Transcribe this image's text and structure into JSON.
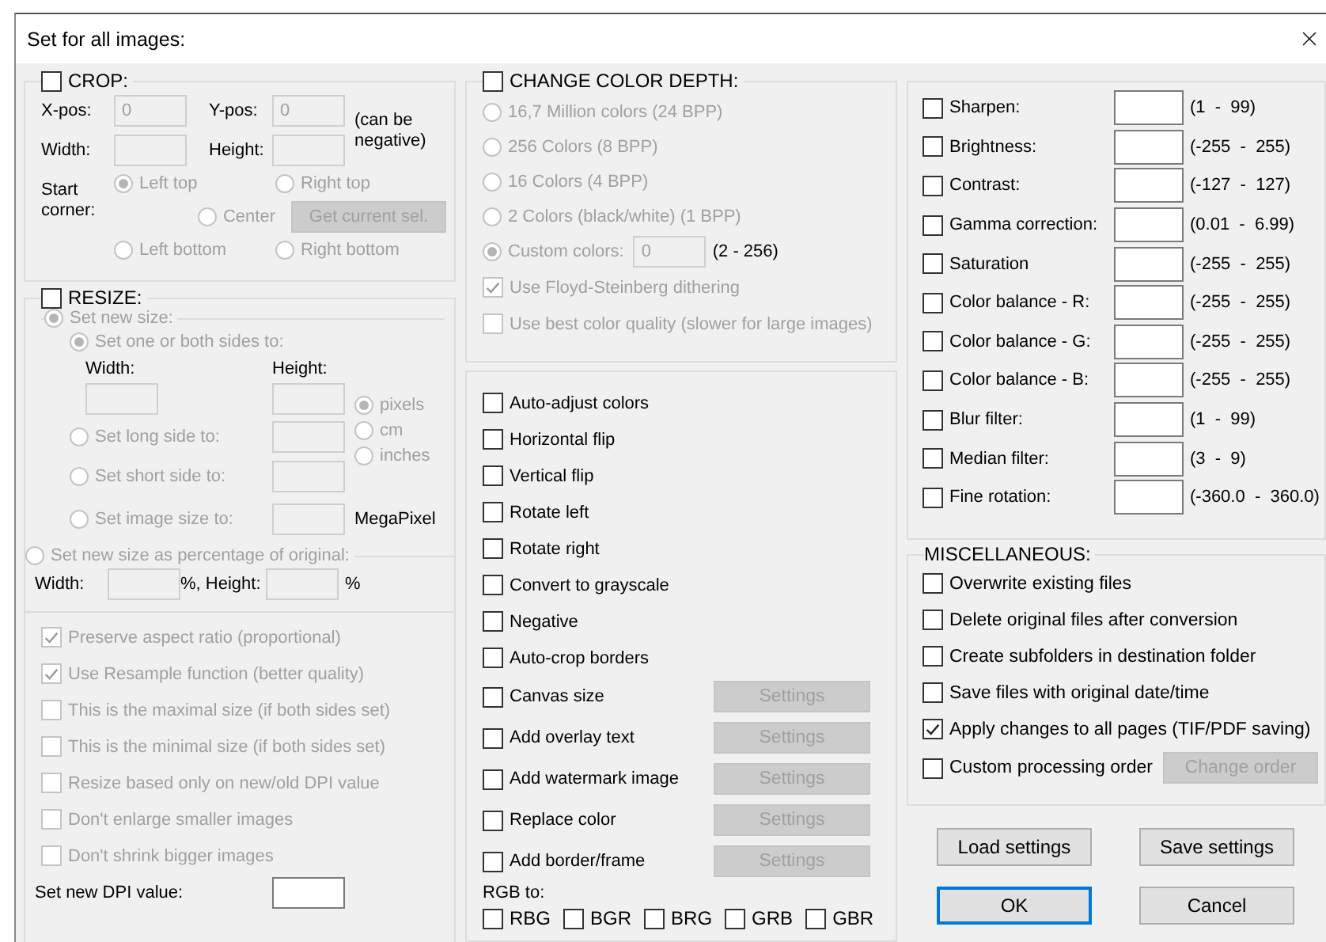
{
  "window": {
    "title": "Set for all images:"
  },
  "crop": {
    "label": "CROP:",
    "checked": false,
    "disabled": true,
    "fields": [
      {
        "label": "X-pos:",
        "value": "0"
      },
      {
        "label": "Y-pos:",
        "value": "0"
      },
      {
        "label": "Width:"
      },
      {
        "label": "Height:"
      }
    ],
    "note": "(can be negative)",
    "corner_label": "Start corner:",
    "corners": [
      {
        "label": "Left top",
        "selected": true
      },
      {
        "label": "Right top",
        "selected": false
      },
      {
        "label": "Center",
        "selected": false
      },
      {
        "label": "Left bottom",
        "selected": false
      },
      {
        "label": "Right bottom",
        "selected": false
      }
    ],
    "get_button": "Get current sel."
  },
  "resize": {
    "label": "RESIZE:",
    "checked": false,
    "disabled": true,
    "modes": [
      {
        "label": "Set new size:",
        "selected": true
      },
      {
        "label": "Set new size as percentage of original:",
        "selected": false
      }
    ],
    "size_options": [
      {
        "label": "Set one or both sides to:",
        "selected": true
      },
      {
        "label": "Set long side to:",
        "selected": false
      },
      {
        "label": "Set short side to:",
        "selected": false
      },
      {
        "label": "Set image size to:",
        "selected": false,
        "suffix": "MegaPixel"
      }
    ],
    "width_label": "Width:",
    "height_label": "Height:",
    "units": [
      {
        "label": "pixels",
        "selected": true
      },
      {
        "label": "cm",
        "selected": false
      },
      {
        "label": "inches",
        "selected": false
      }
    ],
    "percent": {
      "width_label": "Width:",
      "middle": "%, Height:",
      "end": "%"
    },
    "options": [
      {
        "label": "Preserve aspect ratio (proportional)",
        "checked": true,
        "disabled": true
      },
      {
        "label": "Use Resample function (better quality)",
        "checked": true,
        "disabled": true
      },
      {
        "label": "This is the maximal size (if both sides set)",
        "checked": false,
        "disabled": true
      },
      {
        "label": "This is the minimal size (if both sides set)",
        "checked": false,
        "disabled": true
      },
      {
        "label": "Resize based only on new/old DPI value",
        "checked": false,
        "disabled": true
      },
      {
        "label": "Don't enlarge smaller images",
        "checked": false,
        "disabled": true
      },
      {
        "label": "Don't shrink bigger images",
        "checked": false,
        "disabled": true
      }
    ],
    "dpi_label": "Set new DPI value:"
  },
  "color_depth": {
    "label": "CHANGE COLOR DEPTH:",
    "checked": false,
    "disabled": true,
    "options": [
      {
        "label": "16,7 Million colors (24 BPP)",
        "selected": false
      },
      {
        "label": "256 Colors (8 BPP)",
        "selected": false
      },
      {
        "label": "16 Colors (4 BPP)",
        "selected": false
      },
      {
        "label": "2 Colors (black/white) (1 BPP)",
        "selected": false
      },
      {
        "label": "Custom colors:",
        "selected": true,
        "value": "0",
        "range": "(2 - 256)"
      }
    ],
    "checks": [
      {
        "label": "Use Floyd-Steinberg dithering",
        "checked": true
      },
      {
        "label": "Use best color quality (slower for large images)",
        "checked": false
      }
    ]
  },
  "transforms": [
    {
      "label": "Auto-adjust colors",
      "checked": false
    },
    {
      "label": "Horizontal flip",
      "checked": false
    },
    {
      "label": "Vertical flip",
      "checked": false
    },
    {
      "label": "Rotate left",
      "checked": false
    },
    {
      "label": "Rotate right",
      "checked": false
    },
    {
      "label": "Convert to grayscale",
      "checked": false
    },
    {
      "label": "Negative",
      "checked": false
    },
    {
      "label": "Auto-crop borders",
      "checked": false
    },
    {
      "label": "Canvas size",
      "checked": false,
      "settings": {
        "label": "Settings",
        "disabled": true
      }
    },
    {
      "label": "Add overlay text",
      "checked": false,
      "settings": {
        "label": "Settings",
        "disabled": true
      }
    },
    {
      "label": "Add watermark image",
      "checked": false,
      "settings": {
        "label": "Settings",
        "disabled": true
      }
    },
    {
      "label": "Replace color",
      "checked": false,
      "settings": {
        "label": "Settings",
        "disabled": true
      }
    },
    {
      "label": "Add border/frame",
      "checked": false,
      "settings": {
        "label": "Settings",
        "disabled": true
      }
    }
  ],
  "rgb_label": "RGB to:",
  "rgb": [
    {
      "label": "RBG",
      "checked": false
    },
    {
      "label": "BGR",
      "checked": false
    },
    {
      "label": "BRG",
      "checked": false
    },
    {
      "label": "GRB",
      "checked": false
    },
    {
      "label": "GBR",
      "checked": false
    }
  ],
  "filters": [
    {
      "label": "Sharpen:",
      "checked": false,
      "range": "(1  -  99)"
    },
    {
      "label": "Brightness:",
      "checked": false,
      "range": "(-255  -  255)"
    },
    {
      "label": "Contrast:",
      "checked": false,
      "range": "(-127  -  127)"
    },
    {
      "label": "Gamma correction:",
      "checked": false,
      "range": "(0.01  -  6.99)"
    },
    {
      "label": "Saturation",
      "checked": false,
      "range": "(-255  -  255)"
    },
    {
      "label": "Color balance - R:",
      "checked": false,
      "range": "(-255  -  255)"
    },
    {
      "label": "Color balance - G:",
      "checked": false,
      "range": "(-255  -  255)"
    },
    {
      "label": "Color balance - B:",
      "checked": false,
      "range": "(-255  -  255)"
    },
    {
      "label": "Blur filter:",
      "checked": false,
      "range": "(1  -  99)"
    },
    {
      "label": "Median filter:",
      "checked": false,
      "range": "(3  -  9)"
    },
    {
      "label": "Fine rotation:",
      "checked": false,
      "range": "(-360.0  -  360.0)"
    }
  ],
  "misc": {
    "title": "MISCELLANEOUS:",
    "items": [
      {
        "label": "Overwrite existing files",
        "checked": false
      },
      {
        "label": "Delete original files after conversion",
        "checked": false
      },
      {
        "label": "Create subfolders in destination folder",
        "checked": false
      },
      {
        "label": "Save files with original date/time",
        "checked": false
      },
      {
        "label": "Apply changes to all pages (TIF/PDF saving)",
        "checked": true
      },
      {
        "label": "Custom processing order",
        "checked": false,
        "button": {
          "label": "Change order",
          "disabled": true
        }
      }
    ]
  },
  "buttons": [
    {
      "label": "Load settings",
      "kind": "plain"
    },
    {
      "label": "Save settings",
      "kind": "plain"
    },
    {
      "label": "OK",
      "kind": "default"
    },
    {
      "label": "Cancel",
      "kind": "plain"
    }
  ]
}
